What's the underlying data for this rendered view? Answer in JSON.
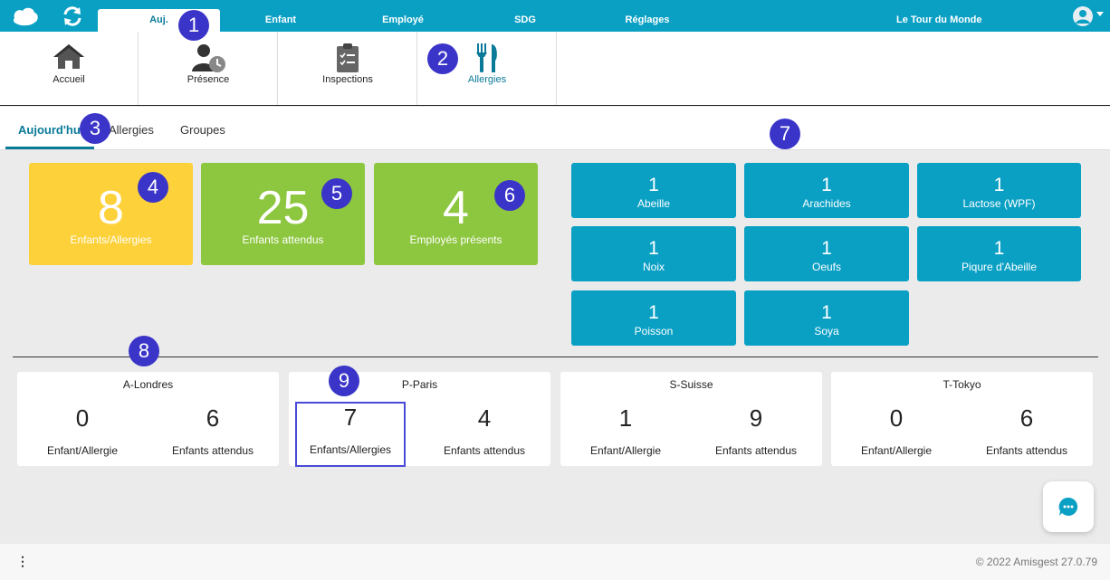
{
  "topbar": {
    "icons": [
      "logo-icon",
      "sync-icon"
    ],
    "tabs": [
      {
        "label": "Auj.",
        "active": true
      },
      {
        "label": "Enfant",
        "active": false
      },
      {
        "label": "Employé",
        "active": false
      },
      {
        "label": "SDG",
        "active": false
      },
      {
        "label": "Réglages",
        "active": false
      }
    ],
    "organization": "Le Tour du Monde",
    "accent_color": "#0aa0c4"
  },
  "modules": [
    {
      "label": "Accueil",
      "icon": "home-icon",
      "active": false
    },
    {
      "label": "Présence",
      "icon": "user-clock-icon",
      "active": false
    },
    {
      "label": "Inspections",
      "icon": "clipboard-icon",
      "active": false
    },
    {
      "label": "Allergies",
      "icon": "utensils-icon",
      "active": true
    }
  ],
  "subtabs": [
    {
      "label": "Aujourd'hui",
      "active": true
    },
    {
      "label": "Allergies",
      "active": false
    },
    {
      "label": "Groupes",
      "active": false
    }
  ],
  "stats": [
    {
      "value": "8",
      "label": "Enfants/Allergies",
      "color": "#fdd13a"
    },
    {
      "value": "25",
      "label": "Enfants attendus",
      "color": "#8dc63f"
    },
    {
      "value": "4",
      "label": "Employés présents",
      "color": "#8dc63f"
    }
  ],
  "allergies": [
    {
      "count": "1",
      "name": "Abeille"
    },
    {
      "count": "1",
      "name": "Arachides"
    },
    {
      "count": "1",
      "name": "Lactose (WPF)"
    },
    {
      "count": "1",
      "name": "Noix"
    },
    {
      "count": "1",
      "name": "Oeufs"
    },
    {
      "count": "1",
      "name": "Piqure d'Abeille"
    },
    {
      "count": "1",
      "name": "Poisson"
    },
    {
      "count": "1",
      "name": "Soya"
    }
  ],
  "groups": [
    {
      "name": "A-Londres",
      "allergy_count": "0",
      "allergy_label": "Enfant/Allergie",
      "expected_count": "6",
      "expected_label": "Enfants attendus"
    },
    {
      "name": "P-Paris",
      "allergy_count": "7",
      "allergy_label": "Enfants/Allergies",
      "expected_count": "4",
      "expected_label": "Enfants attendus"
    },
    {
      "name": "S-Suisse",
      "allergy_count": "1",
      "allergy_label": "Enfant/Allergie",
      "expected_count": "9",
      "expected_label": "Enfants attendus"
    },
    {
      "name": "T-Tokyo",
      "allergy_count": "0",
      "allergy_label": "Enfant/Allergie",
      "expected_count": "6",
      "expected_label": "Enfants attendus"
    }
  ],
  "callouts": [
    "1",
    "2",
    "3",
    "4",
    "5",
    "6",
    "7",
    "8",
    "9"
  ],
  "footer": {
    "menu_glyph": "⋮",
    "copyright": "© 2022 Amisgest 27.0.79"
  }
}
